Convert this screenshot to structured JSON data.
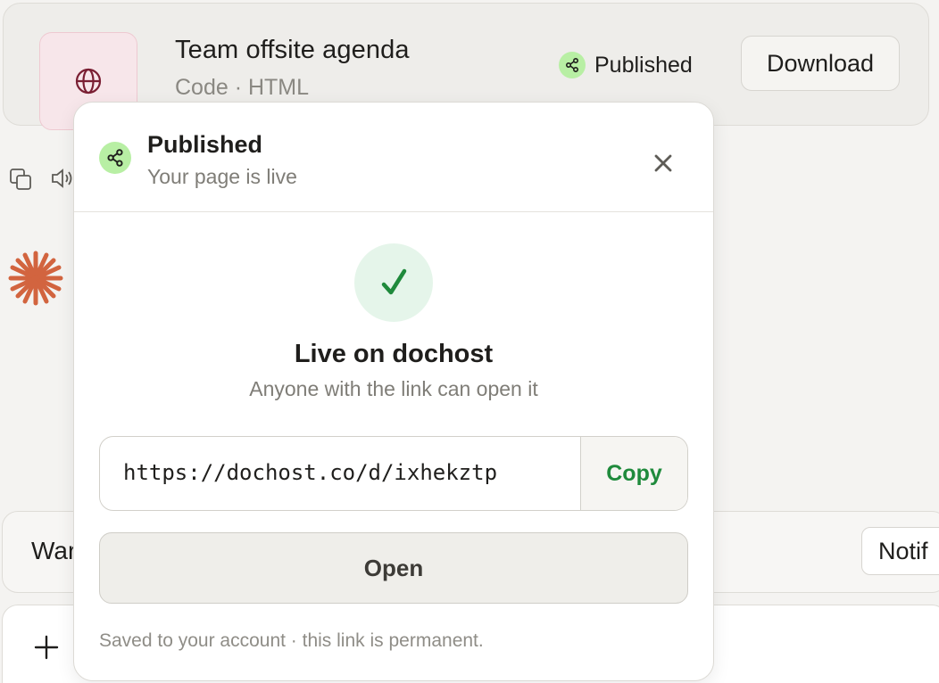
{
  "artifact": {
    "title": "Team offsite agenda",
    "subtitle": "Code · HTML",
    "status": "Published",
    "download_label": "Download",
    "thumb_icon": "globe-icon"
  },
  "chat": {
    "input_text": "War",
    "notif_label": "Notif"
  },
  "popover": {
    "title": "Published",
    "subtitle": "Your page is live",
    "live_title": "Live on dochost",
    "live_subtitle": "Anyone with the link can open it",
    "url": "https://dochost.co/d/ixhekztp",
    "copy_label": "Copy",
    "open_label": "Open",
    "footer": "Saved to your account · this link is permanent."
  },
  "colors": {
    "accent_green": "#1f8a3c",
    "share_badge": "#b8efa4",
    "spark_orange": "#d2643f",
    "thumb_bg": "#f7e6ea"
  }
}
